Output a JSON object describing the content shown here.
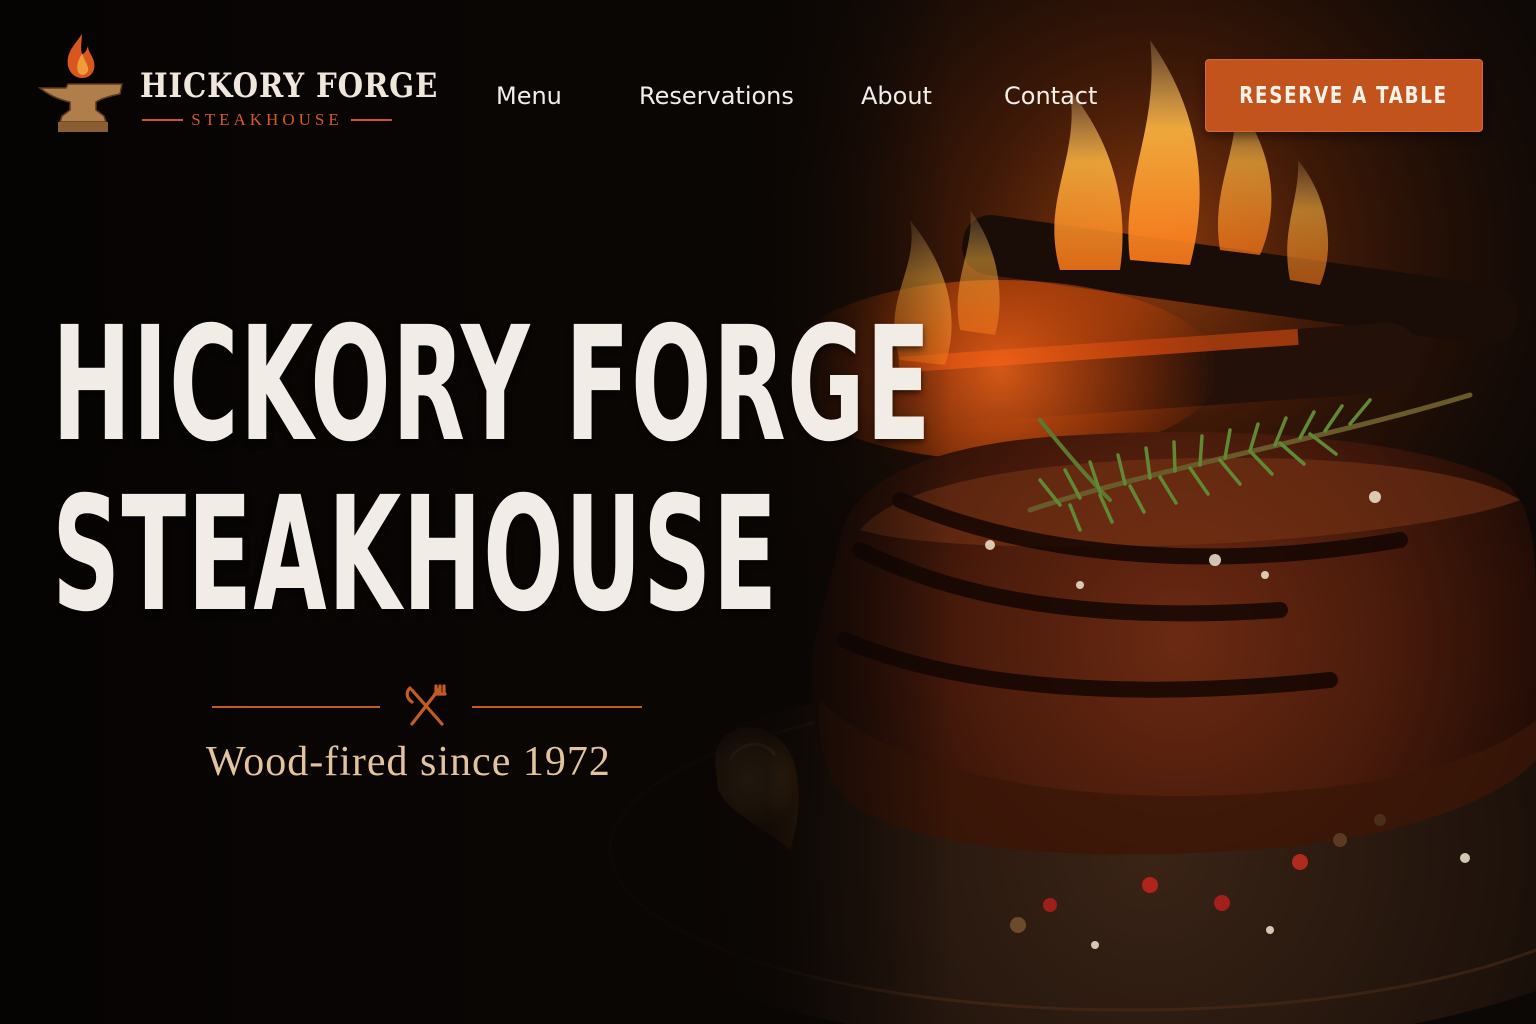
{
  "brand": {
    "name": "HICKORY FORGE",
    "subtitle": "STEAKHOUSE",
    "logo_icon": "flaming-anvil-icon",
    "accent_color": "#c3531d"
  },
  "nav": {
    "items": [
      {
        "label": "Menu"
      },
      {
        "label": "Reservations"
      },
      {
        "label": "About"
      },
      {
        "label": "Contact"
      }
    ],
    "cta_label": "RESERVE A TABLE"
  },
  "hero": {
    "title_line1": "HICKORY FORGE",
    "title_line2": "STEAKHOUSE",
    "divider_icon": "crossed-fork-knife-icon",
    "tagline": "Wood-fired since 1972",
    "background": "grilled-steak-with-rosemary-and-fire-photo"
  }
}
